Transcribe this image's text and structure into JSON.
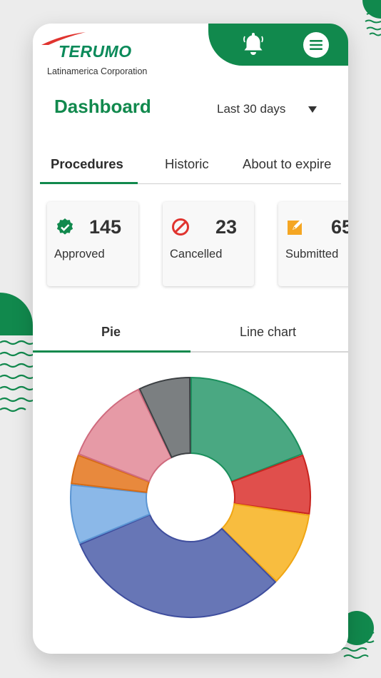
{
  "brand": {
    "name": "TERUMO",
    "subtitle": "Latinamerica Corporation"
  },
  "header": {
    "bell_icon": "bell-icon",
    "menu_icon": "menu-icon",
    "accent": "#11894d"
  },
  "page": {
    "title": "Dashboard"
  },
  "date_range": {
    "selected": "Last 30 days"
  },
  "tabs": [
    {
      "label": "Procedures",
      "active": true
    },
    {
      "label": "Historic",
      "active": false
    },
    {
      "label": "About to expire",
      "active": false
    }
  ],
  "stats": [
    {
      "value": "145",
      "label": "Approved",
      "icon": "check-badge-icon",
      "color": "#11894d"
    },
    {
      "value": "23",
      "label": "Cancelled",
      "icon": "ban-icon",
      "color": "#e0342f"
    },
    {
      "value": "65",
      "label": "Submitted",
      "icon": "edit-box-icon",
      "color": "#f5a623"
    }
  ],
  "chart_tabs": [
    {
      "label": "Pie",
      "active": true
    },
    {
      "label": "Line chart",
      "active": false
    }
  ],
  "chart_data": {
    "type": "pie",
    "donut": true,
    "slices": [
      {
        "value": 19,
        "color": "#4aa882",
        "stroke": "#1b8f5c"
      },
      {
        "value": 8,
        "color": "#e04f4c",
        "stroke": "#c8241f"
      },
      {
        "value": 10,
        "color": "#f8bd3f",
        "stroke": "#f0a614"
      },
      {
        "value": 31,
        "color": "#6776b6",
        "stroke": "#3f4e9e"
      },
      {
        "value": 8,
        "color": "#8bb8e8",
        "stroke": "#5b95d3"
      },
      {
        "value": 4,
        "color": "#e8893d",
        "stroke": "#d66b14"
      },
      {
        "value": 12,
        "color": "#e69aa6",
        "stroke": "#cf6b7e"
      },
      {
        "value": 7,
        "color": "#7b7f81",
        "stroke": "#3d4144"
      }
    ]
  }
}
